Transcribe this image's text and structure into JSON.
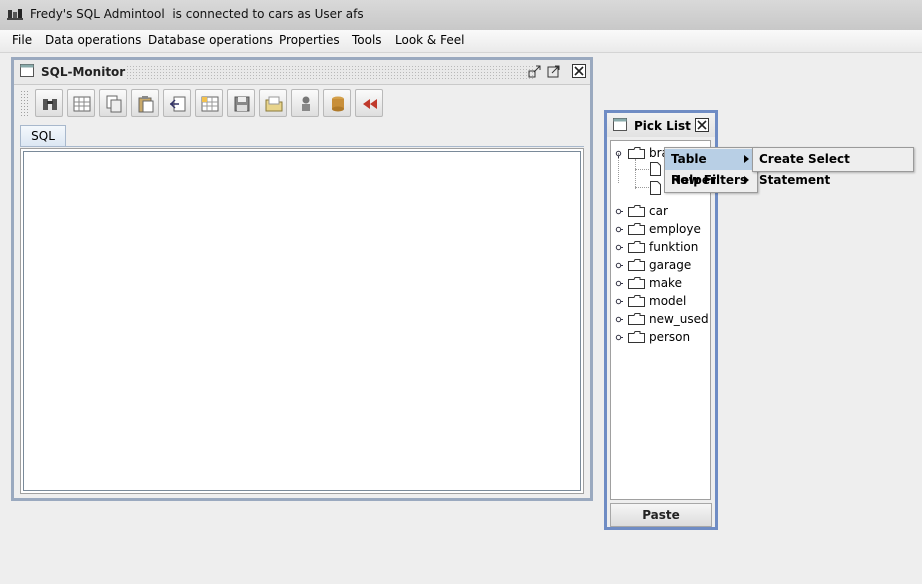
{
  "window": {
    "title": "Fredy's SQL Admintool  is connected to cars as User afs"
  },
  "menubar": [
    "File",
    "Data operations",
    "Database operations",
    "Properties",
    "Tools",
    "Look & Feel"
  ],
  "sql_monitor": {
    "title": "SQL-Monitor",
    "toolbar_icons": [
      "binoculars-icon",
      "table-icon",
      "copy-icon",
      "paste-icon",
      "import-icon",
      "grid-new-icon",
      "save-icon",
      "open-icon",
      "user-icon",
      "database-icon",
      "rewind-icon"
    ],
    "tab": "SQL"
  },
  "pick_list": {
    "title": "Pick List",
    "tree": [
      {
        "label": "bra",
        "expanded": true
      },
      {
        "label": "car"
      },
      {
        "label": "employe"
      },
      {
        "label": "funktion"
      },
      {
        "label": "garage"
      },
      {
        "label": "make"
      },
      {
        "label": "model"
      },
      {
        "label": "new_used"
      },
      {
        "label": "person"
      }
    ],
    "paste_label": "Paste"
  },
  "context_menu": {
    "items": [
      {
        "label": "Table Helper",
        "selected": true
      },
      {
        "label": "Row Filters",
        "selected": false
      }
    ],
    "submenu": {
      "label": "Create Select Statement"
    }
  },
  "colors": {
    "frame_border": "#9aa9bf",
    "active_frame_border": "#6f8cc4",
    "menu_selection": "#b8cfe5"
  }
}
